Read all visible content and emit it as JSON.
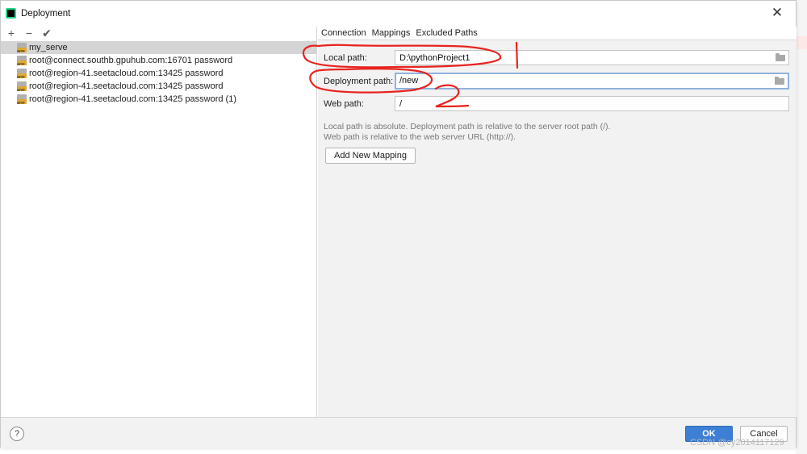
{
  "window": {
    "title": "Deployment",
    "app_icon": "pycharm-icon",
    "close_icon": "close-icon"
  },
  "toolbar": {
    "add": "+",
    "remove": "−",
    "default": "✔"
  },
  "servers": [
    {
      "label": "my_serve",
      "selected": true
    },
    {
      "label": "root@connect.southb.gpuhub.com:16701 password",
      "selected": false
    },
    {
      "label": "root@region-41.seetacloud.com:13425 password",
      "selected": false
    },
    {
      "label": "root@region-41.seetacloud.com:13425 password",
      "selected": false
    },
    {
      "label": "root@region-41.seetacloud.com:13425 password (1)",
      "selected": false
    }
  ],
  "tabs": [
    "Connection",
    "Mappings",
    "Excluded Paths"
  ],
  "mappings": {
    "local_path_label": "Local path:",
    "local_path_value": "D:\\pythonProject1",
    "deployment_path_label": "Deployment path:",
    "deployment_path_value": "/new",
    "web_path_label": "Web path:",
    "web_path_value": "/",
    "help_line1": "Local path is absolute. Deployment path is relative to the server root path (/).",
    "help_line2": "Web path is relative to the web server URL (http://).",
    "add_mapping_label": "Add New Mapping"
  },
  "footer": {
    "help": "?",
    "ok": "OK",
    "cancel": "Cancel"
  },
  "watermark": "CSDN @cy2014117129",
  "colors": {
    "accent": "#3c7fd4",
    "annotation": "#e8231f",
    "selection": "#d5d5d5"
  }
}
